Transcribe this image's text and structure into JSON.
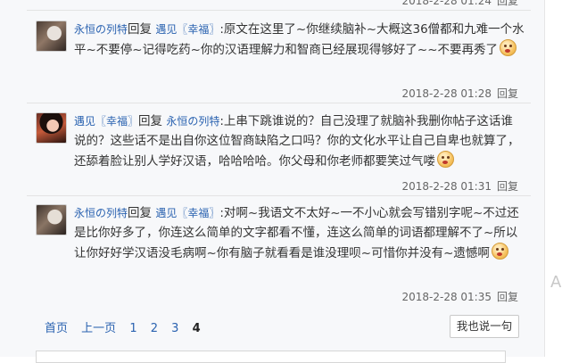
{
  "posts": [
    {
      "author": "永恒の列特",
      "reply_word": "回复",
      "reply_to": "遇见〖幸福〗",
      "text": ":原文在这里了~你继续脑补~大概这36僧都和九难一个水平~不要停~记得吃药~你的汉语理解力和智商已经展现得够好了~~不要再秀了",
      "emoji": "smiley-icon",
      "time": "2018-2-28 01:28",
      "reply_label": "回复"
    },
    {
      "author": "遇见〖幸福〗",
      "reply_word": "回复",
      "reply_to": "永恒の列特",
      "text": ":上串下跳谁说的？自己没理了就脑补我删你帖子这话谁说的？这些话不是出自你这位智商缺陷之口吗？你的文化水平让自己自卑也就算了，还舔着脸让别人学好汉语，哈哈哈哈。你父母和你老师都要笑过气喽",
      "emoji": "smiley-icon",
      "time": "2018-2-28 01:31",
      "reply_label": "回复"
    },
    {
      "author": "永恒の列特",
      "reply_word": "回复",
      "reply_to": "遇见〖幸福〗",
      "text": ":对啊~我语文不太好~一不小心就会写错别字呢~不过还是比你好多了，你连这么简单的文字都看不懂，连这么简单的词语都理解不了~所以让你好好学汉语没毛病啊~你有脑子就看看是谁没理呗~可惜你并没有~遗憾啊",
      "emoji": "smiley-icon",
      "time": "2018-2-28 01:35",
      "reply_label": "回复"
    }
  ],
  "pager": {
    "first": "首页",
    "prev": "上一页",
    "pages": [
      "1",
      "2",
      "3"
    ],
    "current": "4"
  },
  "say_button": "我也说一句",
  "gutter_glyph": "A"
}
